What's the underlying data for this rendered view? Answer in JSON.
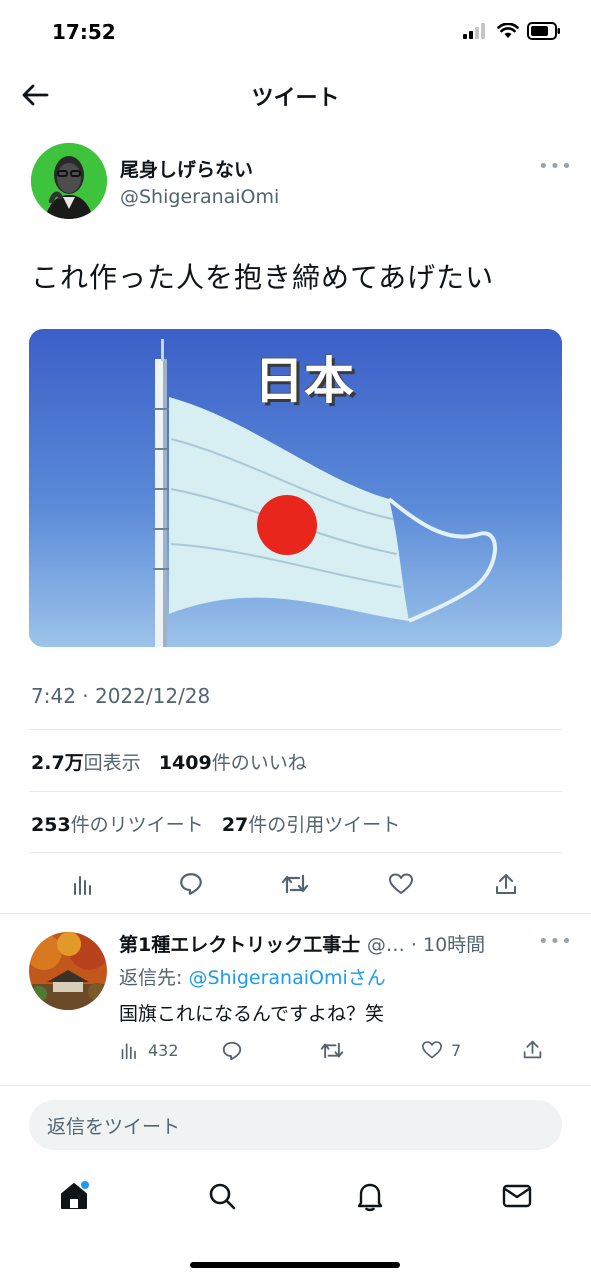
{
  "status_bar": {
    "time": "17:52"
  },
  "nav": {
    "title": "ツイート"
  },
  "tweet": {
    "author_name": "尾身しげらない",
    "author_handle": "@ShigeranaiOmi",
    "text": "これ作った人を抱き締めてあげたい",
    "image_caption": "日本",
    "timestamp": "7:42 · 2022/12/28",
    "views_count": "2.7万",
    "views_label": "回表示",
    "likes_count": "1409",
    "likes_label": "件のいいね",
    "retweets_count": "253",
    "retweets_label": "件のリツイート",
    "quotes_count": "27",
    "quotes_label": "件の引用ツイート"
  },
  "reply": {
    "author_name": "第1種エレクトリック工事士",
    "handle_time": "@… · 10時間",
    "reply_to_label": "返信先:",
    "reply_to_handle": "@ShigeranaiOmi",
    "reply_to_suffix": "さん",
    "text": "国旗これになるんですよね？笑",
    "views": "432",
    "likes": "7"
  },
  "compose": {
    "placeholder": "返信をツイート"
  },
  "colors": {
    "accent": "#1d9bf0",
    "avatar_bg": "#3ec43c",
    "flag_red": "#e8261c"
  },
  "icons": [
    "back-arrow-icon",
    "more-icon",
    "analytics-icon",
    "reply-icon",
    "retweet-icon",
    "like-icon",
    "share-icon",
    "home-icon",
    "search-icon",
    "notifications-icon",
    "messages-icon"
  ]
}
